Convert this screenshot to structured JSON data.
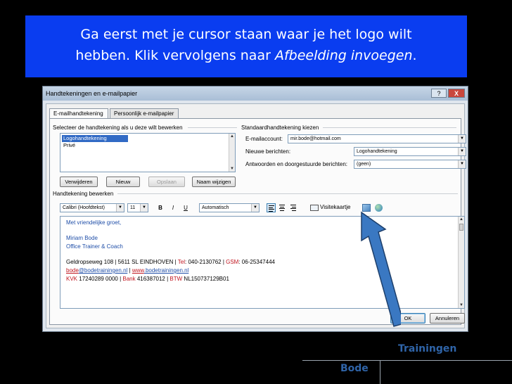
{
  "banner": {
    "line1": "Ga eerst met je cursor staan waar je het logo wilt",
    "line2_prefix": "hebben. Klik vervolgens naar ",
    "line2_emph": "Afbeelding invoegen",
    "line2_suffix": "."
  },
  "dialog": {
    "title": "Handtekeningen en e-mailpapier",
    "help_glyph": "?",
    "close_glyph": "X",
    "tabs": [
      {
        "label": "E-mailhandtekening",
        "active": true
      },
      {
        "label": "Persoonlijk e-mailpapier",
        "active": false
      }
    ],
    "select_label": "Selecteer de handtekening als u deze wilt bewerken",
    "signatures": [
      "Logohandtekening",
      "Privé"
    ],
    "buttons": {
      "delete": "Verwijderen",
      "new": "Nieuw",
      "save": "Opslaan",
      "rename": "Naam wijzigen",
      "ok": "OK",
      "cancel": "Annuleren"
    },
    "default_section": {
      "label": "Standaardhandtekening kiezen",
      "account_label": "E-mailaccount:",
      "account_value": "mir.bode@hotmail.com",
      "new_messages_label": "Nieuwe berichten:",
      "new_messages_value": "Logohandtekening",
      "replies_label": "Antwoorden en doorgestuurde berichten:",
      "replies_value": "(geen)"
    },
    "edit_label": "Handtekening bewerken",
    "toolbar": {
      "font": "Calibri (Hoofdtekst)",
      "size": "11",
      "bold": "B",
      "italic": "I",
      "underline": "U",
      "color": "Automatisch",
      "business_card": "Visitekaartje"
    },
    "signature_text": {
      "greeting": "Met vriendelijke groet,",
      "name": "Miriam Bode",
      "role": "Office Trainer & Coach",
      "address_a": "Geldropseweg 108  |  5611 SL EINDHOVEN  |  ",
      "tel_label": "Tel",
      "tel_value": ": 040-2130762  |  ",
      "gsm_label": "GSM",
      "gsm_value": ": 06-25347444",
      "email_a": "bode",
      "email_b": "@bodetrainingen.nl",
      "email_sep": "  |  ",
      "web_a": "www",
      "web_b": ".bodetrainingen.nl",
      "kvk_label": "KVK",
      "kvk_value": "  17240289  0000  |  ",
      "bank_label": "Bank",
      "bank_value": " 416387012  |  ",
      "btw_label": "BTW",
      "btw_value": "  NL150737129B01"
    }
  },
  "logo": {
    "trainingen": "Trainingen",
    "bode": "Bode"
  },
  "colors": {
    "banner_bg": "#0a3df0",
    "arrow": "#3a78c2",
    "logo": "#2f64a8"
  },
  "icons": [
    "insert-picture-icon",
    "hyperlink-icon",
    "business-card-icon",
    "close-icon",
    "help-icon",
    "dropdown-arrow-icon"
  ]
}
